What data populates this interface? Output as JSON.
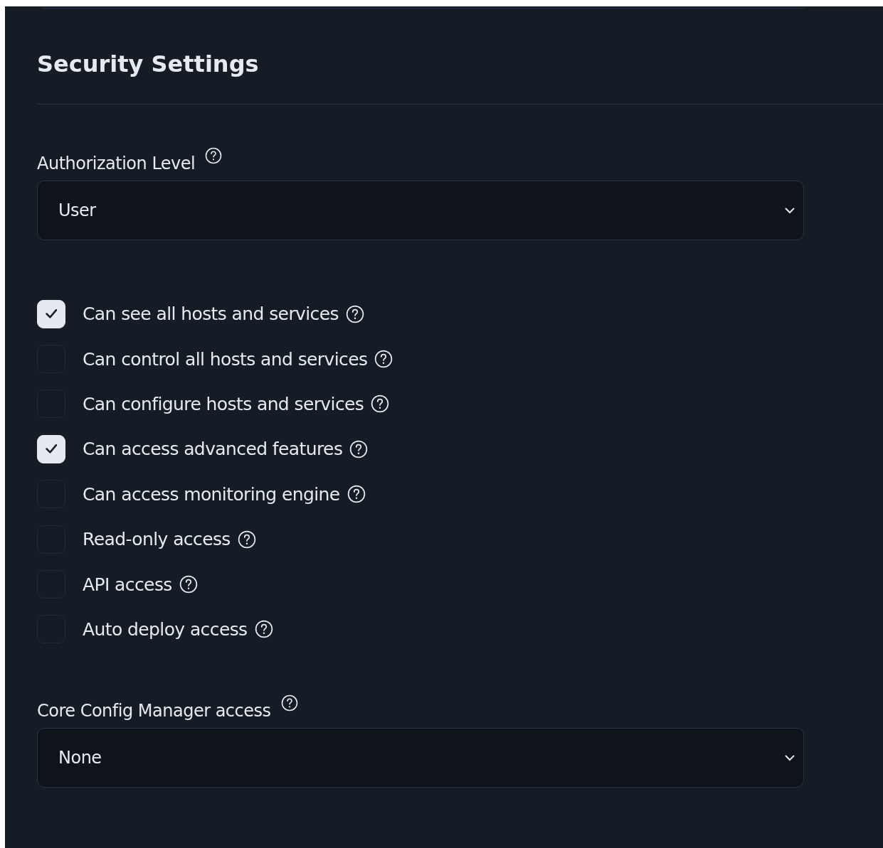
{
  "section": {
    "title": "Security Settings"
  },
  "authorization_level": {
    "label": "Authorization Level",
    "value": "User"
  },
  "permissions": [
    {
      "label": "Can see all hosts and services",
      "checked": true
    },
    {
      "label": "Can control all hosts and services",
      "checked": false
    },
    {
      "label": "Can configure hosts and services",
      "checked": false
    },
    {
      "label": "Can access advanced features",
      "checked": true
    },
    {
      "label": "Can access monitoring engine",
      "checked": false
    },
    {
      "label": "Read-only access",
      "checked": false
    },
    {
      "label": "API access",
      "checked": false
    },
    {
      "label": "Auto deploy access",
      "checked": false
    }
  ],
  "core_config_manager_access": {
    "label": "Core Config Manager access",
    "value": "None"
  }
}
